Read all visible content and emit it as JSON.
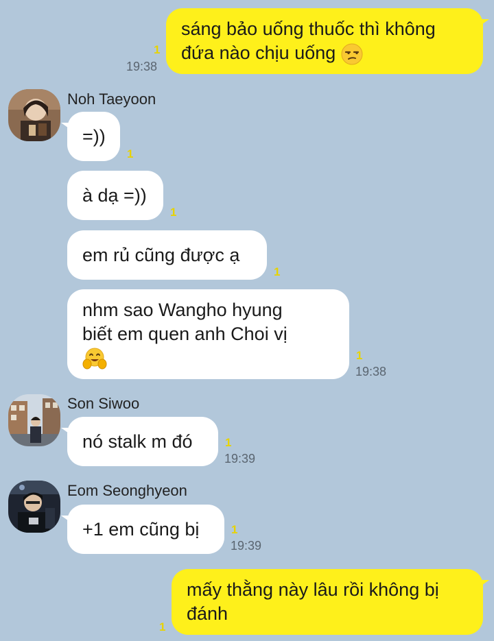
{
  "messages": [
    {
      "from": "me",
      "lines": [
        "sáng bảo uống thuốc thì không",
        "đứa nào chịu uống"
      ],
      "emoji": "unamused-face-icon",
      "unread": "1",
      "time": "19:38"
    },
    {
      "from": "them",
      "sender": "Noh Taeyoon",
      "lines": [
        "=))"
      ],
      "unread": "1"
    },
    {
      "from": "them",
      "lines": [
        "à dạ =))"
      ],
      "unread": "1"
    },
    {
      "from": "them",
      "lines": [
        "em rủ cũng được ạ"
      ],
      "unread": "1"
    },
    {
      "from": "them",
      "lines": [
        "nhm sao Wangho hyung",
        "biết em quen anh Choi vị"
      ],
      "emoji": "hugging-face-icon",
      "unread": "1",
      "time": "19:38"
    },
    {
      "from": "them",
      "sender": "Son Siwoo",
      "lines": [
        "nó stalk m đó"
      ],
      "unread": "1",
      "time": "19:39"
    },
    {
      "from": "them",
      "sender": "Eom Seonghyeon",
      "lines": [
        "+1 em cũng bị"
      ],
      "unread": "1",
      "time": "19:39"
    },
    {
      "from": "me",
      "lines": [
        "mấy thằng này lâu rồi không bị",
        "đánh"
      ],
      "unread": "1"
    }
  ],
  "colors": {
    "background": "#b2c7da",
    "my_bubble": "#fef01b",
    "their_bubble": "#ffffff",
    "unread": "#e7d300"
  }
}
